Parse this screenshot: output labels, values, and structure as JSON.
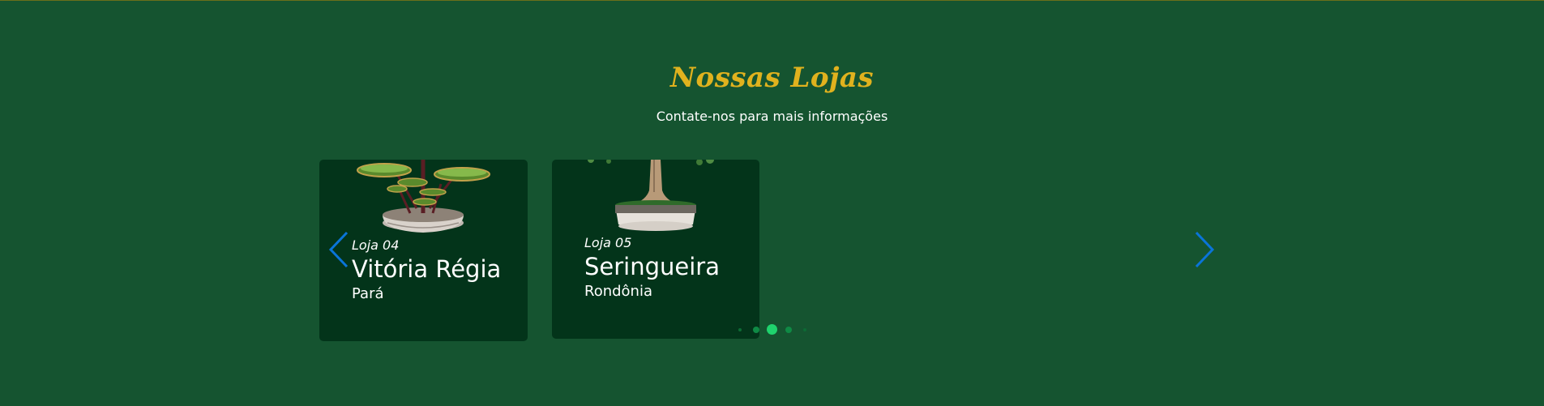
{
  "section": {
    "title": "Nossas Lojas",
    "subtitle": "Contate-nos para mais informações"
  },
  "stores": [
    {
      "label": "Loja 04",
      "name": "Vitória Régia",
      "state": "Pará",
      "image_icon": "water-lily-bonsai-image"
    },
    {
      "label": "Loja 05",
      "name": "Seringueira",
      "state": "Rondônia",
      "image_icon": "rubber-tree-bonsai-image"
    }
  ],
  "carousel": {
    "prev_icon": "chevron-left-icon",
    "next_icon": "chevron-right-icon",
    "arrow_color": "#0a74d8",
    "pagination": {
      "total": 5,
      "active": 3
    }
  },
  "colors": {
    "background": "#155430",
    "card": "#03341a",
    "title": "#e0b21e",
    "dot_active": "#1fd36d"
  }
}
